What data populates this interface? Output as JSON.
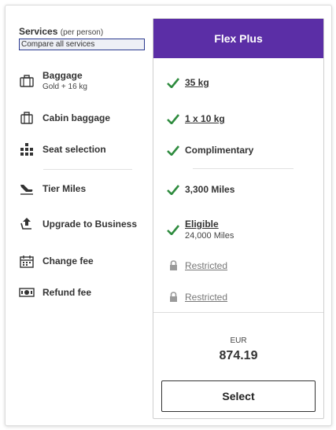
{
  "services": {
    "title": "Services",
    "subtitle": "(per person)",
    "compare_link": "Compare all services",
    "items": [
      {
        "label": "Baggage",
        "sub": "Gold + 16 kg",
        "icon": "suitcase-icon"
      },
      {
        "label": "Cabin baggage",
        "sub": "",
        "icon": "cabin-bag-icon"
      },
      {
        "label": "Seat selection",
        "sub": "",
        "icon": "seat-icon"
      },
      {
        "label": "Tier Miles",
        "sub": "",
        "icon": "plane-icon"
      },
      {
        "label": "Upgrade to Business",
        "sub": "",
        "icon": "upgrade-icon"
      },
      {
        "label": "Change fee",
        "sub": "",
        "icon": "calendar-icon"
      },
      {
        "label": "Refund fee",
        "sub": "",
        "icon": "money-icon"
      }
    ]
  },
  "fare": {
    "name": "Flex Plus",
    "values": [
      {
        "text": "35 kg",
        "sub": "",
        "status": "included"
      },
      {
        "text": "1 x 10 kg",
        "sub": "",
        "status": "included"
      },
      {
        "text": "Complimentary",
        "sub": "",
        "status": "included"
      },
      {
        "text": "3,300 Miles",
        "sub": "",
        "status": "included"
      },
      {
        "text": "Eligible",
        "sub": "24,000 Miles",
        "status": "included"
      },
      {
        "text": "Restricted",
        "sub": "",
        "status": "restricted"
      },
      {
        "text": "Restricted",
        "sub": "",
        "status": "restricted"
      }
    ],
    "currency": "EUR",
    "price": "874.19",
    "select_label": "Select"
  },
  "colors": {
    "brand": "#5b2ea6",
    "check": "#2e8b3e",
    "lock": "#9a9a9a"
  }
}
